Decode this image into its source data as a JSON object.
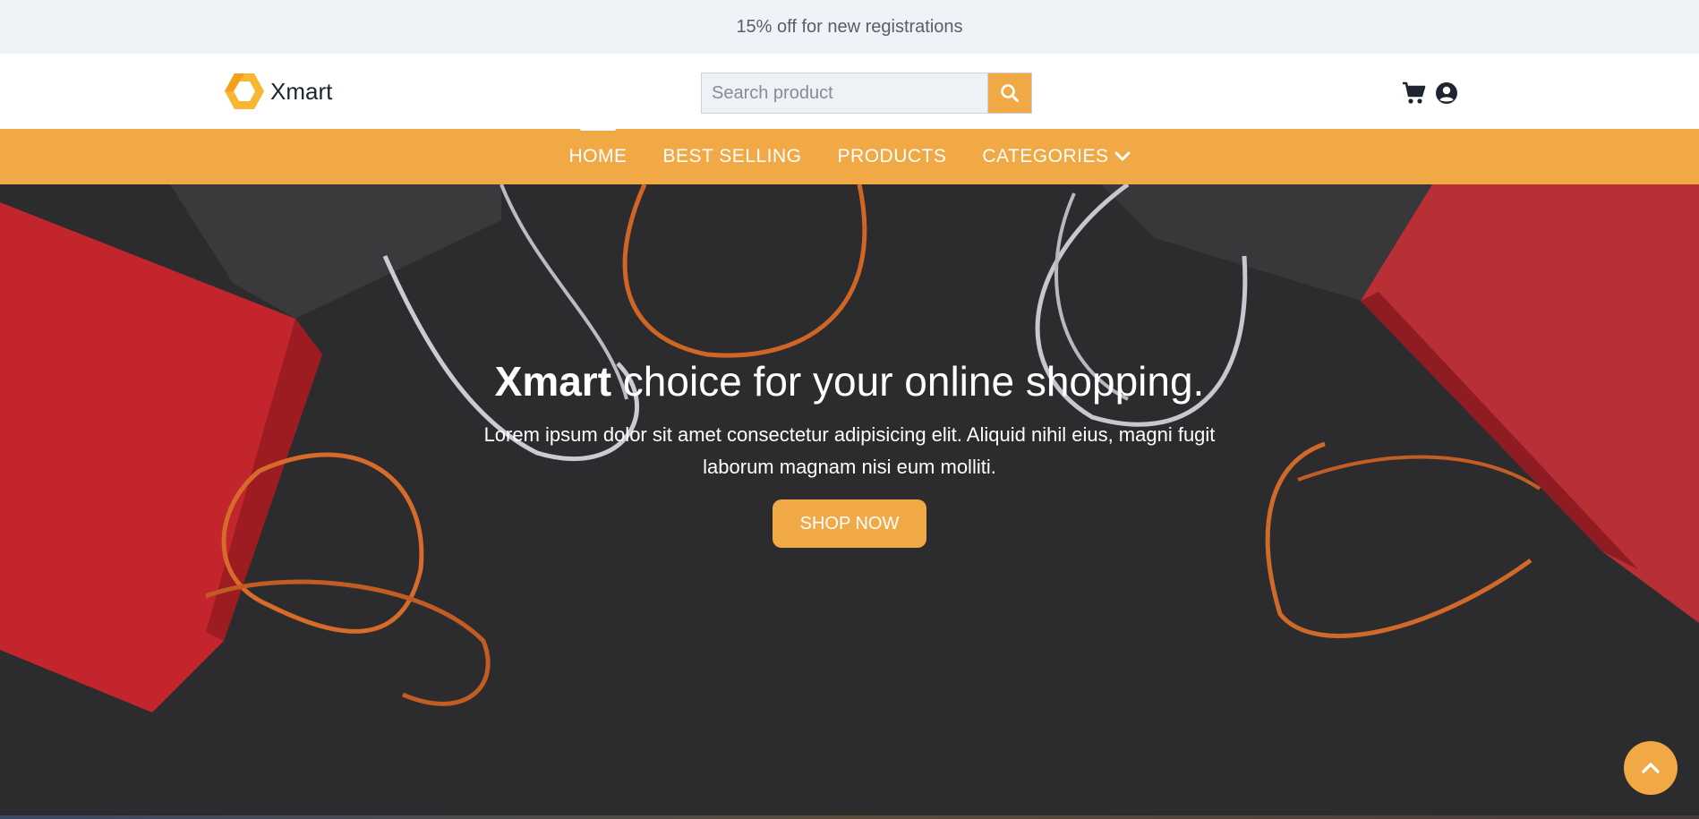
{
  "promo": {
    "text": "15% off for new registrations"
  },
  "header": {
    "brand": "Xmart",
    "search": {
      "placeholder": "Search product",
      "value": ""
    },
    "icons": [
      "cart-icon",
      "user-account-icon"
    ]
  },
  "nav": {
    "items": [
      {
        "label": "HOME",
        "active": true
      },
      {
        "label": "BEST SELLING",
        "active": false
      },
      {
        "label": "PRODUCTS",
        "active": false
      },
      {
        "label": "CATEGORIES",
        "active": false,
        "dropdown": true
      }
    ]
  },
  "hero": {
    "title_brand": "Xmart",
    "title_rest": " choice for your online shopping.",
    "text": "Lorem ipsum dolor sit amet consectetur adipisicing elit. Aliquid nihil eius, magni fugit laborum magnam nisi eum molliti.",
    "button": "SHOP NOW"
  },
  "colors": {
    "accent": "#f0a944",
    "promo_bg": "#eff2f7",
    "hero_bg": "#2b2b2e"
  }
}
